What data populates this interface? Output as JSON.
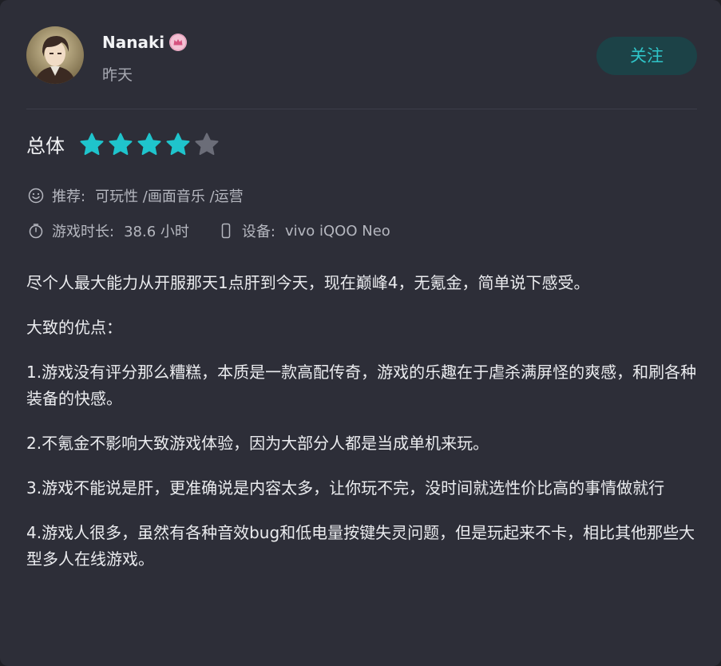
{
  "user": {
    "name": "Nanaki",
    "badge_icon": "crown-badge-icon",
    "time": "昨天",
    "follow_label": "关注"
  },
  "rating": {
    "label": "总体",
    "value": 4,
    "max": 5,
    "filled_color": "#1fc4cc",
    "empty_color": "#6b6d78"
  },
  "meta": {
    "recommend_icon": "smile-icon",
    "recommend_label": "推荐:",
    "recommend_value": "可玩性 /画面音乐 /运营",
    "playtime_icon": "stopwatch-icon",
    "playtime_label": "游戏时长:",
    "playtime_value": "38.6 小时",
    "device_icon": "phone-icon",
    "device_label": "设备:",
    "device_value": "vivo iQOO Neo"
  },
  "review": {
    "paragraphs": [
      "尽个人最大能力从开服那天1点肝到今天，现在巅峰4，无氪金，简单说下感受。",
      "大致的优点：",
      "1.游戏没有评分那么糟糕，本质是一款高配传奇，游戏的乐趣在于虐杀满屏怪的爽感，和刷各种装备的快感。",
      "2.不氪金不影响大致游戏体验，因为大部分人都是当成单机来玩。",
      "3.游戏不能说是肝，更准确说是内容太多，让你玩不完，没时间就选性价比高的事情做就行",
      "4.游戏人很多，虽然有各种音效bug和低电量按键失灵问题，但是玩起来不卡，相比其他那些大型多人在线游戏。"
    ]
  },
  "colors": {
    "card_bg": "#2d2e38",
    "accent": "#2fc5c9",
    "follow_bg": "#1c4247"
  }
}
